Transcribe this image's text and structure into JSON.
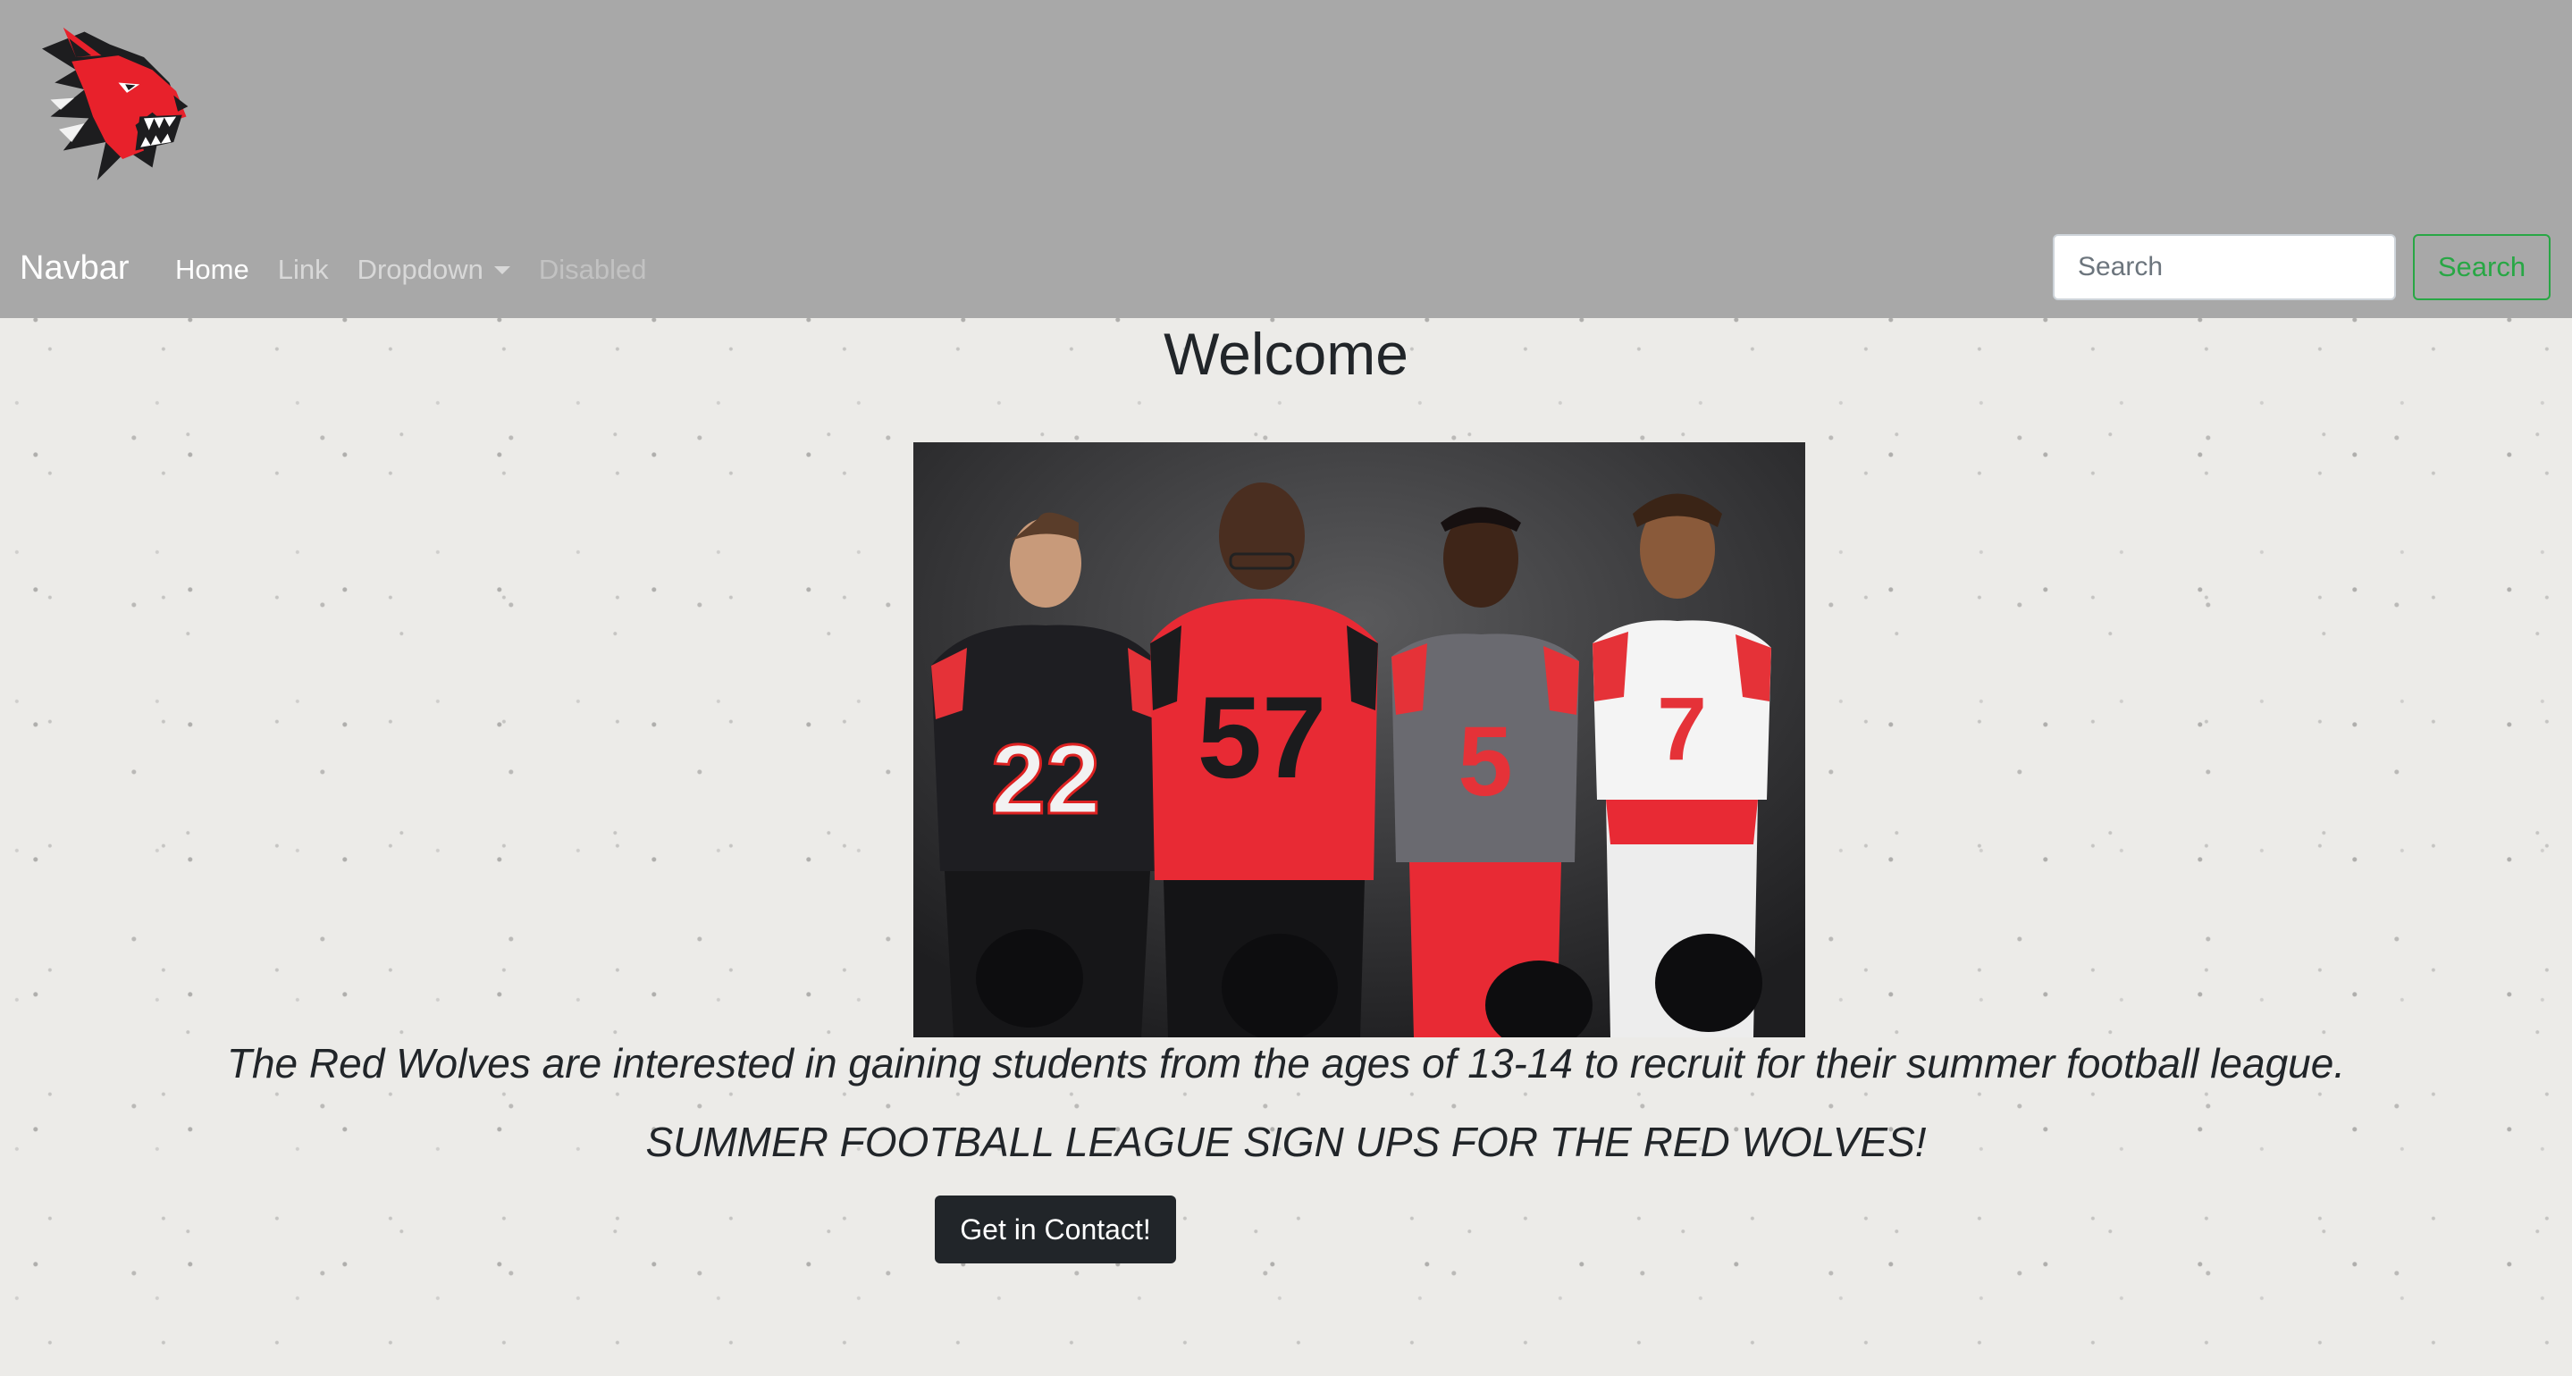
{
  "header": {
    "logo_icon": "red-wolf-logo-icon"
  },
  "navbar": {
    "brand": "Navbar",
    "links": [
      {
        "label": "Home",
        "state": "active"
      },
      {
        "label": "Link",
        "state": "normal"
      },
      {
        "label": "Dropdown",
        "state": "dropdown"
      },
      {
        "label": "Disabled",
        "state": "disabled"
      }
    ],
    "search": {
      "placeholder": "Search",
      "value": "",
      "button_label": "Search"
    }
  },
  "main": {
    "title": "Welcome",
    "photo_alt": "",
    "tagline": "The Red Wolves are interested in gaining students from the ages of 13-14 to recruit for their summer football league.",
    "subtagline": "SUMMER FOOTBALL LEAGUE SIGN UPS FOR THE RED WOLVES!",
    "contact_button": "Get in Contact!"
  },
  "colors": {
    "header_bg": "#a8a8a8",
    "accent_red": "#e8212b",
    "success_green": "#28a745",
    "dark_button": "#212529"
  }
}
